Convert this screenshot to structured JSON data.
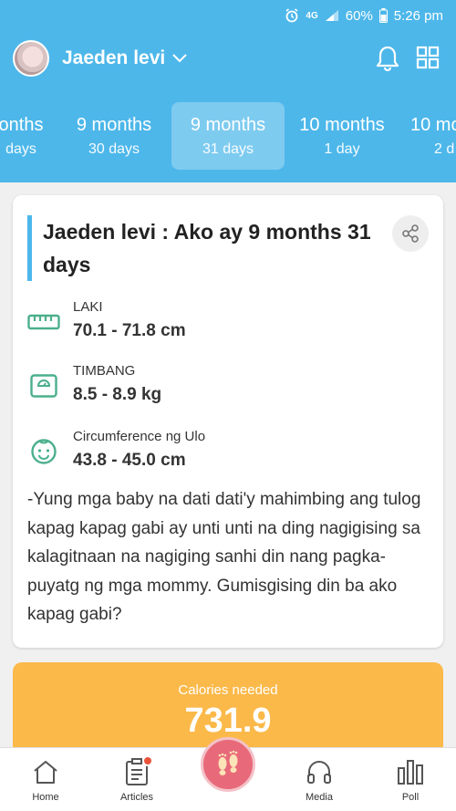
{
  "status_bar": {
    "network": "4G",
    "battery": "60%",
    "time": "5:26 pm"
  },
  "header": {
    "username": "Jaeden levi"
  },
  "tabs": [
    {
      "title": "onths",
      "sub": "days"
    },
    {
      "title": "9 months",
      "sub": "30 days"
    },
    {
      "title": "9 months",
      "sub": "31 days"
    },
    {
      "title": "10 months",
      "sub": "1 day"
    },
    {
      "title": "10 mo",
      "sub": "2 d"
    }
  ],
  "card": {
    "title": "Jaeden levi : Ako ay 9 months 31 days",
    "metrics": [
      {
        "label": "LAKI",
        "value": "70.1 - 71.8 cm"
      },
      {
        "label": "TIMBANG",
        "value": "8.5 - 8.9 kg"
      },
      {
        "label": "Circumference ng Ulo",
        "value": "43.8 - 45.0 cm"
      }
    ],
    "description": "-Yung mga baby na dati dati'y mahimbing ang tulog kapag kapag gabi ay unti unti na ding nagigising sa kalagitnaan na nagiging sanhi din nang pagka-puyatg ng mga mommy. Gumisgising din ba ako kapag gabi?"
  },
  "calories": {
    "label": "Calories needed",
    "value": "731.9"
  },
  "bottom_nav": [
    {
      "label": "Home"
    },
    {
      "label": "Articles"
    },
    {
      "label": ""
    },
    {
      "label": "Media"
    },
    {
      "label": "Poll"
    }
  ],
  "colors": {
    "primary": "#4db7ea",
    "metric_icon": "#4caf8c",
    "calorie_bg": "#fbb94a",
    "center_button": "#e86a7a",
    "badge": "#e8533a"
  }
}
